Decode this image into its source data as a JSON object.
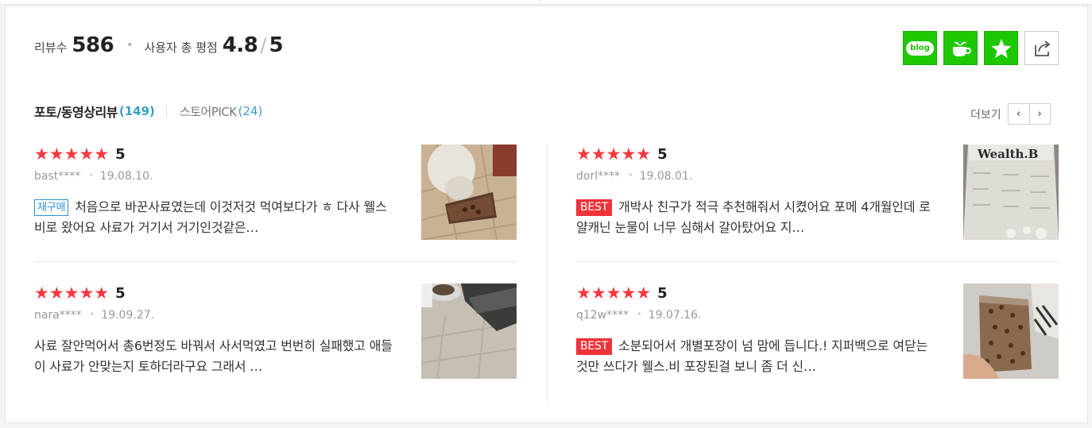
{
  "summary": {
    "review_count_label": "리뷰수",
    "review_count": "586",
    "rating_label": "사용자 총 평점",
    "rating": "4.8",
    "rating_separator": "/",
    "rating_max": "5"
  },
  "share": {
    "blog_text": "blog",
    "icons": [
      "naver-blog-icon",
      "cafe-cup-icon",
      "star-bookmark-icon",
      "share-icon"
    ]
  },
  "tabs": {
    "photo_label": "포토/동영상리뷰",
    "photo_count": "(149)",
    "store_label": "스토어PICK",
    "store_count": "(24)"
  },
  "more": {
    "label": "더보기",
    "prev": "‹",
    "next": "›"
  },
  "colors": {
    "star": "#f5383f",
    "accent_blue": "#3c9fc8",
    "best_badge": "#f0333a",
    "naver_green": "#1ec800"
  },
  "reviews": [
    {
      "stars": "★★★★★",
      "score": "5",
      "user": "bast****",
      "date": "19.08.10.",
      "badge": "재구매",
      "text": "처음으로 바꾼사료였는데 이것저것 먹여보다가 ㅎ 다사 웰스비로 왔어요 사료가 거기서 거기인것같은…"
    },
    {
      "stars": "★★★★★",
      "score": "5",
      "user": "dorl****",
      "date": "19.08.01.",
      "badge": "BEST",
      "text": "개박사 친구가 적극 추천해줘서 시켰어요 포메 4개월인데 로얄캐닌 눈물이 너무 심해서 갈아탔어요 지…"
    },
    {
      "stars": "★★★★★",
      "score": "5",
      "user": "nara****",
      "date": "19.09.27.",
      "badge": "",
      "text": "사료 잘안먹어서 총6번정도 바꿔서 사서먹였고 번번히 실패했고 애들이 사료가 안맞는지 토하더라구요 그래서 …"
    },
    {
      "stars": "★★★★★",
      "score": "5",
      "user": "q12w****",
      "date": "19.07.16.",
      "badge": "BEST",
      "text": "소분되어서 개별포장이 넘 맘에 듭니다.! 지퍼백으로 여닫는것만 쓰다가 웰스.비 포장된걸 보니 좀 더 신…"
    }
  ],
  "thumb_text": "Wealth.B"
}
